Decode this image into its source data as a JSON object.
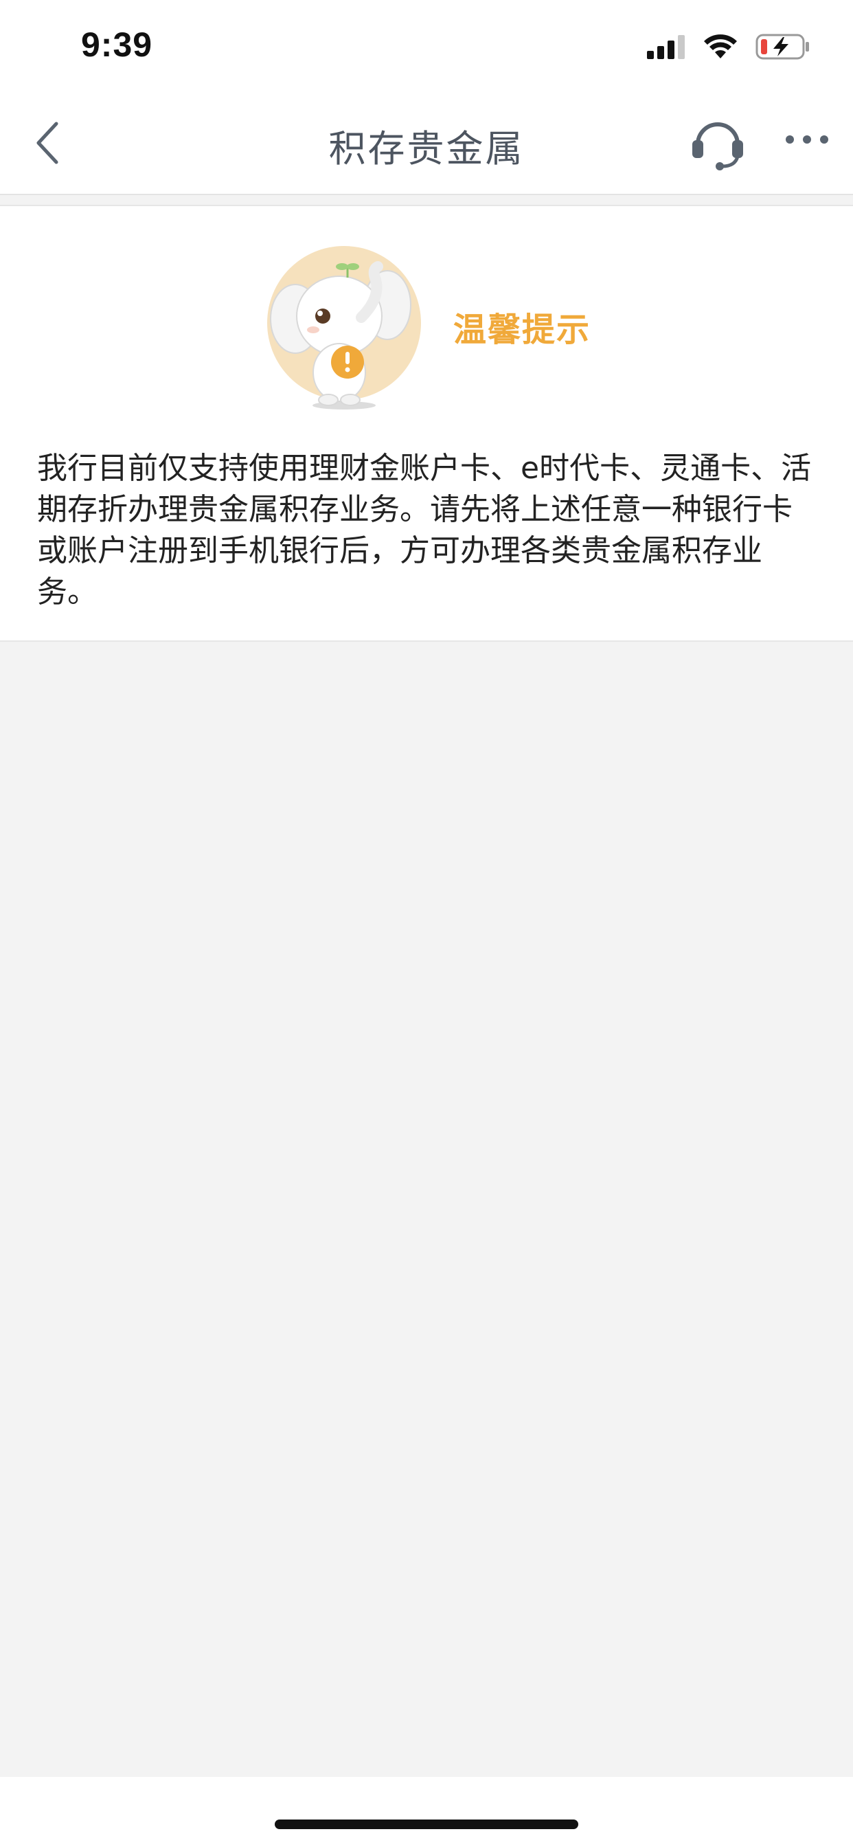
{
  "status_bar": {
    "time": "9:39",
    "icons": [
      "signal-icon",
      "wifi-icon",
      "battery-charging-icon"
    ]
  },
  "nav": {
    "title": "积存贵金属",
    "back_icon": "chevron-left-icon",
    "support_icon": "headset-icon",
    "more_icon": "more-dots-icon"
  },
  "tip": {
    "title": "温馨提示",
    "message": "我行目前仅支持使用理财金账户卡、e时代卡、灵通卡、活期存折办理贵金属积存业务。请先将上述任意一种银行卡或账户注册到手机银行后，方可办理各类贵金属积存业务。",
    "mascot": "elephant-mascot-with-exclamation-coin"
  },
  "colors": {
    "accent": "#f0a93a",
    "title": "#4d5560",
    "background": "#f3f3f3"
  }
}
